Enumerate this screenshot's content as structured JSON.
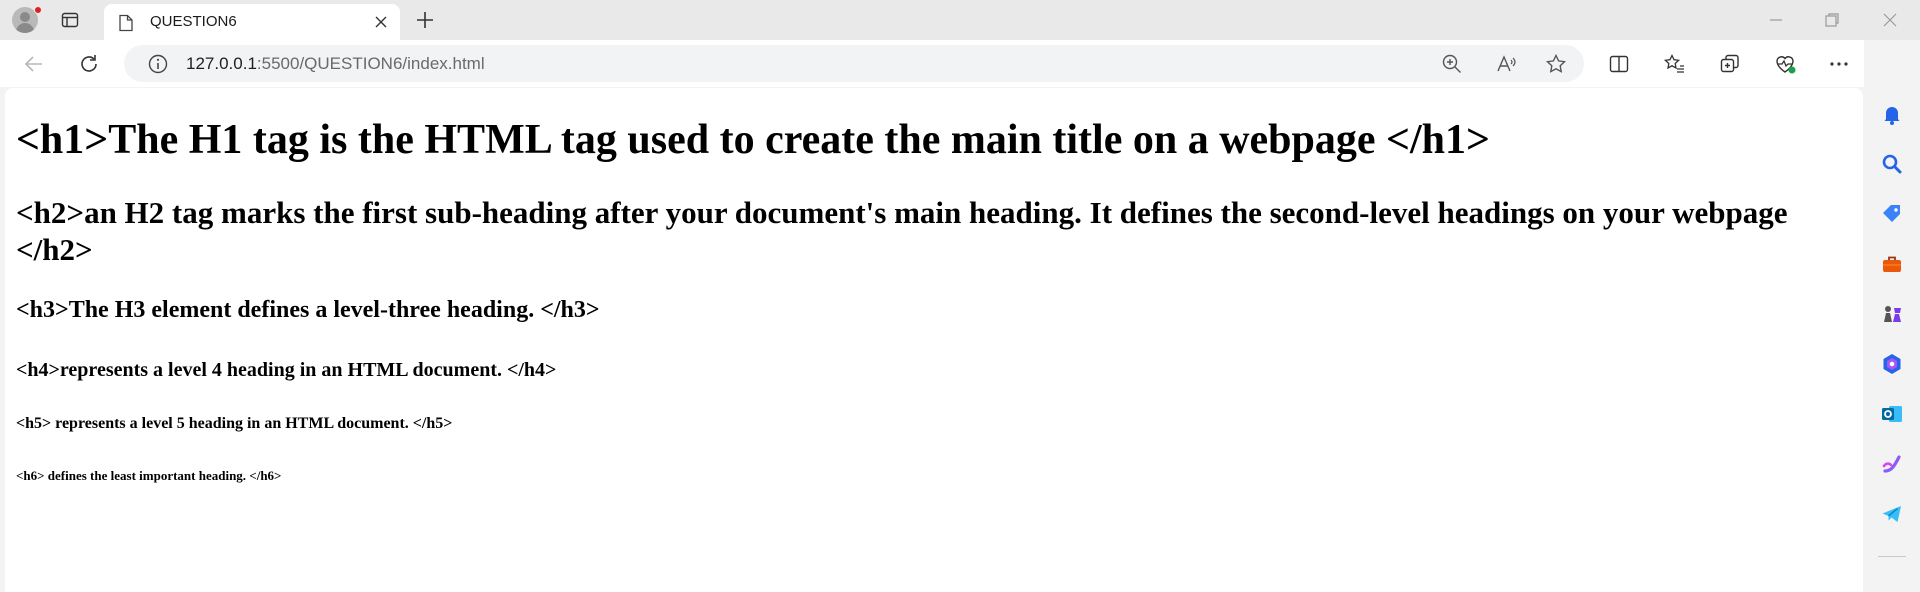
{
  "browser": {
    "tab": {
      "title": "QUESTION6"
    },
    "address": {
      "host": "127.0.0.1",
      "rest": ":5500/QUESTION6/index.html"
    }
  },
  "page": {
    "h1": "<h1>The H1 tag is the HTML tag used to create the main title on a webpage </h1>",
    "h2": "<h2>an H2 tag marks the first sub-heading after your document's main heading. It defines the second-level headings on your webpage </h2>",
    "h3": "<h3>The H3 element defines a level-three heading. </h3>",
    "h4": "<h4>represents a level 4 heading in an HTML document. </h4>",
    "h5": "<h5> represents a level 5 heading in an HTML document. </h5>",
    "h6": "<h6> defines the least important heading. </h6>"
  },
  "colors": {
    "accent": "#0f6cbd",
    "background": "#ffffff",
    "chrome": "#e9e9e9"
  }
}
